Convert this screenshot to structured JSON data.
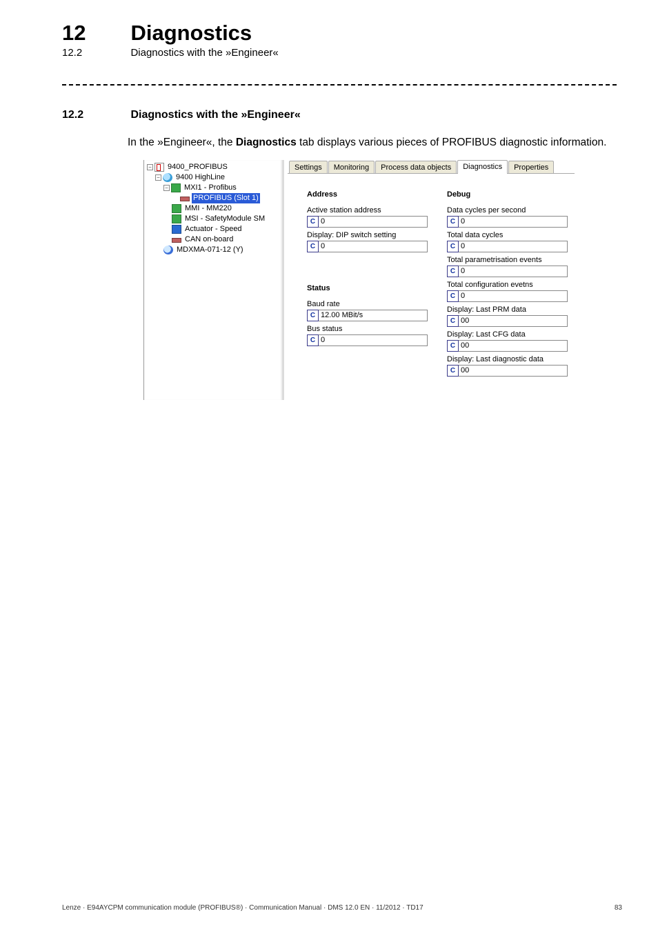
{
  "chapter_number": "12",
  "chapter_title": "Diagnostics",
  "subsection_number": "12.2",
  "subsection_title": "Diagnostics with the »Engineer«",
  "section_heading_number": "12.2",
  "section_heading_title": "Diagnostics with the »Engineer«",
  "intro_pre": "In the »Engineer«, the ",
  "intro_bold": "Diagnostics",
  "intro_post": " tab displays various pieces of PROFIBUS diagnostic information.",
  "tree": {
    "root": "9400_PROFIBUS",
    "n1": "9400 HighLine",
    "n2": "MXI1 - Profibus",
    "n3": "PROFIBUS (Slot 1)",
    "n4": "MMI - MM220",
    "n5": "MSI - SafetyModule SM",
    "n6": "Actuator - Speed",
    "n7": "CAN on-board",
    "n8": "MDXMA-071-12 (Y)"
  },
  "tabs": {
    "t0": "Settings",
    "t1": "Monitoring",
    "t2": "Process data objects",
    "t3": "Diagnostics",
    "t4": "Properties"
  },
  "c_label": "C",
  "address": {
    "head": "Address",
    "f0_label": "Active station address",
    "f0_value": "0",
    "f1_label": "Display: DIP switch setting",
    "f1_value": "0"
  },
  "status": {
    "head": "Status",
    "f0_label": "Baud rate",
    "f0_value": "12.00 MBit/s",
    "f1_label": "Bus status",
    "f1_value": "0"
  },
  "debug": {
    "head": "Debug",
    "f0_label": "Data cycles per second",
    "f0_value": "0",
    "f1_label": "Total data cycles",
    "f1_value": "0",
    "f2_label": "Total parametrisation events",
    "f2_value": "0",
    "f3_label": "Total configuration evetns",
    "f3_value": "0",
    "f4_label": "Display: Last PRM data",
    "f4_value": "00",
    "f5_label": "Display: Last CFG data",
    "f5_value": "00",
    "f6_label": "Display: Last diagnostic data",
    "f6_value": "00"
  },
  "footer_left": "Lenze · E94AYCPM communication module (PROFIBUS®) · Communication Manual · DMS 12.0 EN · 11/2012 · TD17",
  "footer_right": "83"
}
